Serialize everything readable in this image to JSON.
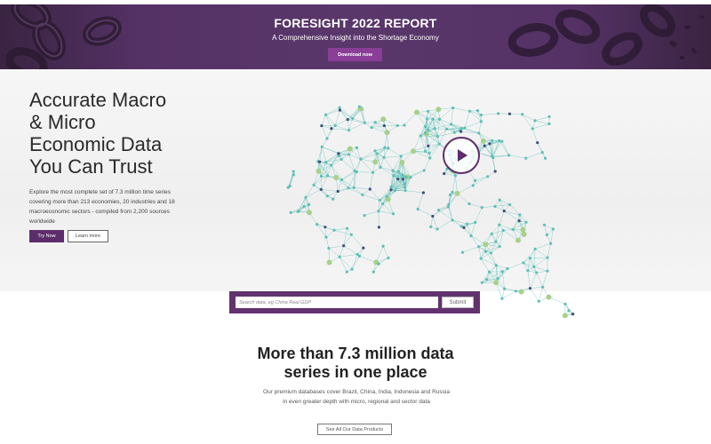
{
  "banner": {
    "title": "FORESIGHT 2022 REPORT",
    "subtitle": "A Comprehensive Insight into the Shortage Economy",
    "download_label": "Download now"
  },
  "hero": {
    "heading_lines": [
      "Accurate Macro",
      "& Micro",
      "Economic Data",
      "You Can Trust"
    ],
    "description": "Explore the most complete set of 7.3 million time series covering more than 213 economies, 20 industries and 18 macroeconomic sectors - compiled from 2,200 sources worldwide",
    "try_label": "Try Now",
    "learn_label": "Learn more"
  },
  "search": {
    "placeholder": "Search data, eg China Real GDP",
    "submit_label": "Submit"
  },
  "lower": {
    "heading_lines": [
      "More than 7.3 million data",
      "series in one place"
    ],
    "description": "Our premium databases cover Brazil, China, India, Indonesia and Russia in even greater depth with micro, regional and sector data",
    "products_label": "See All Our Data Products"
  },
  "colors": {
    "brand_purple": "#5c2d6b",
    "banner_button": "#8a3e97",
    "map_teal": "#5fbfb6",
    "map_green": "#a8d08d",
    "map_navy": "#3e4f7a"
  }
}
